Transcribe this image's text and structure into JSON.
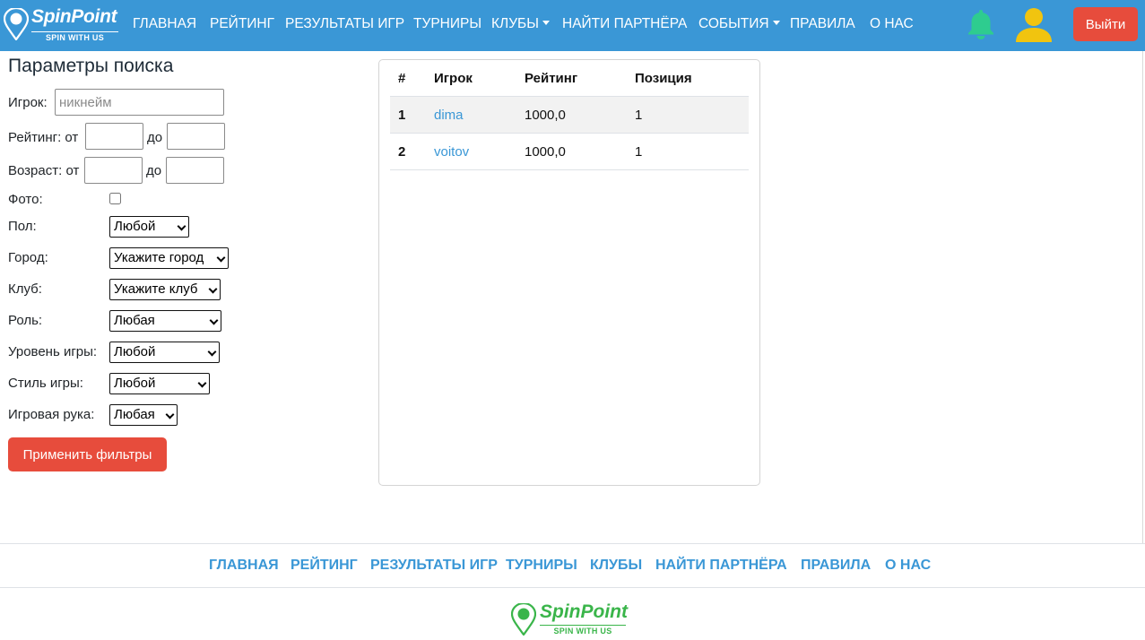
{
  "brand": {
    "name": "SpinPoint",
    "tagline": "SPIN WITH US"
  },
  "colors": {
    "primary": "#3a97d6",
    "accent": "#e74c3c",
    "brand_green": "#3ab54a",
    "bell": "#2ecc8f",
    "user": "#f1c40f"
  },
  "nav": {
    "items": [
      {
        "label": "ГЛАВНАЯ",
        "dropdown": false
      },
      {
        "label": "РЕЙТИНГ",
        "dropdown": false
      },
      {
        "label": "РЕЗУЛЬТАТЫ ИГР",
        "dropdown": false
      },
      {
        "label": "ТУРНИРЫ",
        "dropdown": false
      },
      {
        "label": "КЛУБЫ",
        "dropdown": true
      },
      {
        "label": "НАЙТИ ПАРТНЁРА",
        "dropdown": false
      },
      {
        "label": "СОБЫТИЯ",
        "dropdown": true
      },
      {
        "label": "ПРАВИЛА",
        "dropdown": false
      },
      {
        "label": "О НАС",
        "dropdown": false
      }
    ],
    "icons": {
      "notifications": "bell-icon",
      "profile": "user-icon"
    },
    "logout_label": "Выйти"
  },
  "filters": {
    "title": "Параметры поиска",
    "player": {
      "label": "Игрок:",
      "placeholder": "никнейм",
      "value": ""
    },
    "rating": {
      "label": "Рейтинг: от",
      "to_label": "до",
      "from": "",
      "to": ""
    },
    "age": {
      "label": "Возраст: от",
      "to_label": "до",
      "from": "",
      "to": ""
    },
    "photo": {
      "label": "Фото:",
      "checked": false
    },
    "gender": {
      "label": "Пол:",
      "selected": "Любой"
    },
    "city": {
      "label": "Город:",
      "selected": "Укажите город"
    },
    "club": {
      "label": "Клуб:",
      "selected": "Укажите клуб"
    },
    "role": {
      "label": "Роль:",
      "selected": "Любая"
    },
    "level": {
      "label": "Уровень игры:",
      "selected": "Любой"
    },
    "style": {
      "label": "Стиль игры:",
      "selected": "Любой"
    },
    "hand": {
      "label": "Игровая рука:",
      "selected": "Любая"
    },
    "apply_label": "Применить фильтры"
  },
  "results": {
    "columns": [
      "#",
      "Игрок",
      "Рейтинг",
      "Позиция"
    ],
    "rows": [
      {
        "num": "1",
        "player": "dima",
        "rating": "1000,0",
        "position": "1"
      },
      {
        "num": "2",
        "player": "voitov",
        "rating": "1000,0",
        "position": "1"
      }
    ]
  },
  "footer": {
    "links": [
      "ГЛАВНАЯ",
      "РЕЙТИНГ",
      "РЕЗУЛЬТАТЫ ИГР",
      "ТУРНИРЫ",
      "КЛУБЫ",
      "НАЙТИ ПАРТНЁРА",
      "ПРАВИЛА",
      "О НАС"
    ]
  }
}
